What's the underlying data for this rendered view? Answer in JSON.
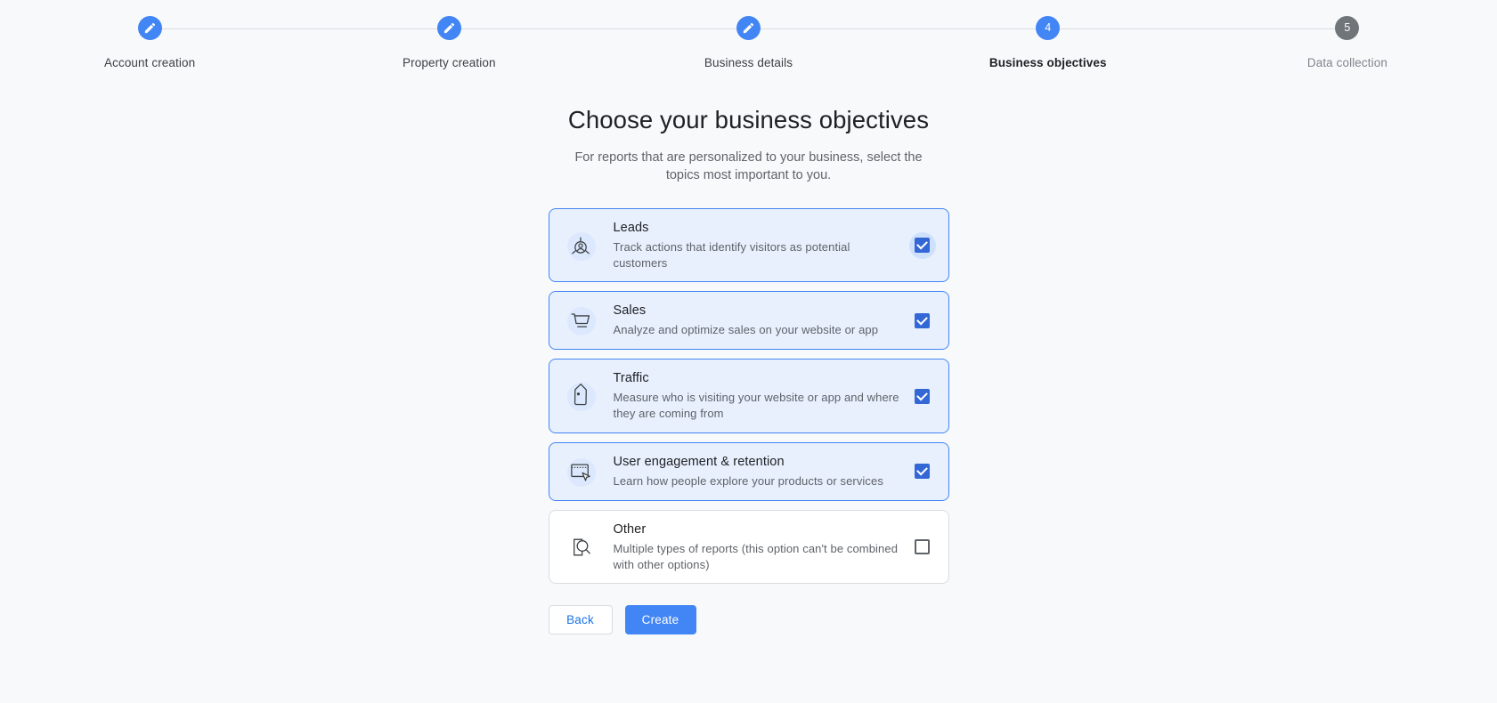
{
  "stepper": {
    "steps": [
      {
        "label": "Account creation",
        "badge": "pencil-icon",
        "state": "done"
      },
      {
        "label": "Property creation",
        "badge": "pencil-icon",
        "state": "done"
      },
      {
        "label": "Business details",
        "badge": "pencil-icon",
        "state": "done"
      },
      {
        "label": "Business objectives",
        "badge": "4",
        "state": "current"
      },
      {
        "label": "Data collection",
        "badge": "5",
        "state": "upcoming"
      }
    ]
  },
  "main": {
    "title": "Choose your business objectives",
    "subtitle": "For reports that are personalized to your business, select the topics most important to you."
  },
  "objectives": [
    {
      "title": "Leads",
      "description": "Track actions that identify visitors as potential customers",
      "icon": "lead-person-target-icon",
      "checked": true,
      "selected": true,
      "focused": true
    },
    {
      "title": "Sales",
      "description": "Analyze and optimize sales on your website or app",
      "icon": "shopping-cart-icon",
      "checked": true,
      "selected": true,
      "focused": false
    },
    {
      "title": "Traffic",
      "description": "Measure who is visiting your website or app and where they are coming from",
      "icon": "price-tag-icon",
      "checked": true,
      "selected": true,
      "focused": false
    },
    {
      "title": "User engagement & retention",
      "description": "Learn how people explore your products or services",
      "icon": "window-cursor-icon",
      "checked": true,
      "selected": true,
      "focused": false
    },
    {
      "title": "Other",
      "description": "Multiple types of reports (this option can't be combined with other options)",
      "icon": "document-magnifier-icon",
      "checked": false,
      "selected": false,
      "focused": false
    }
  ],
  "actions": {
    "back_label": "Back",
    "create_label": "Create"
  },
  "colors": {
    "page_background": "#f8f9fb",
    "accent_blue": "#4285f4",
    "checkbox_blue": "#3367d6",
    "selected_card_bg": "#e8f0fe",
    "selected_card_border": "#4285f4",
    "upcoming_badge_gray": "#70757a",
    "muted_text": "#5f6368",
    "primary_text": "#202124",
    "link_blue": "#1a73e8",
    "border_gray": "#dadce0"
  }
}
